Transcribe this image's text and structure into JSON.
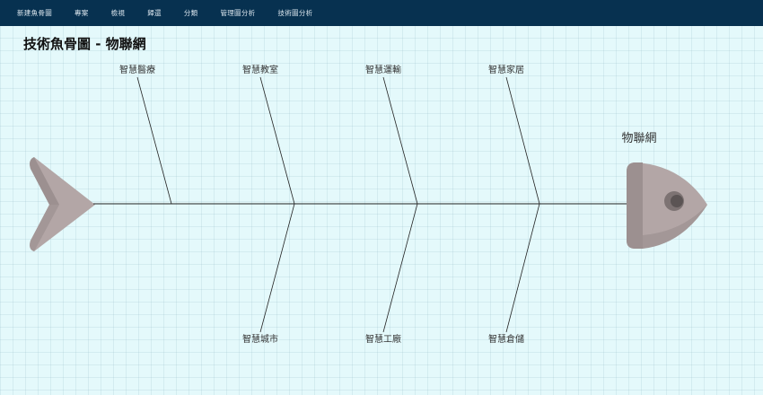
{
  "nav": {
    "items": [
      "新建魚骨圖",
      "專案",
      "檢視",
      "歸還",
      "分類",
      "管理圖分析",
      "技術圖分析"
    ]
  },
  "page": {
    "title": "技術魚骨圖 - 物聯網"
  },
  "diagram": {
    "head_label": "物聯網",
    "top_branches": [
      "智慧醫療",
      "智慧教室",
      "智慧運輸",
      "智慧家居"
    ],
    "bottom_branches": [
      "智慧城市",
      "智慧工廠",
      "智慧倉儲"
    ],
    "colors": {
      "fish": "#b3a6a6",
      "fish_dark": "#9c9090",
      "eye_outer": "#7d7373",
      "eye_inner": "#5b5454",
      "line": "#222222",
      "navbar": "#073150"
    }
  }
}
